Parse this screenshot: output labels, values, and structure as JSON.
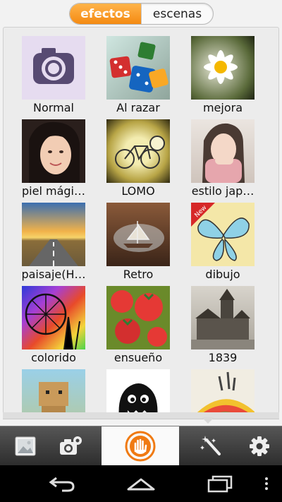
{
  "tabs": [
    {
      "label": "efectos",
      "active": true
    },
    {
      "label": "escenas",
      "active": false
    }
  ],
  "effects": [
    {
      "label": "Normal"
    },
    {
      "label": "Al razar"
    },
    {
      "label": "mejora"
    },
    {
      "label": "piel mági…"
    },
    {
      "label": "LOMO"
    },
    {
      "label": "estilo jap…"
    },
    {
      "label": "paisaje(H…"
    },
    {
      "label": "Retro"
    },
    {
      "label": "dibujo",
      "badge": "New"
    },
    {
      "label": "colorido"
    },
    {
      "label": "ensueño"
    },
    {
      "label": "1839"
    },
    {
      "label": ""
    },
    {
      "label": ""
    },
    {
      "label": ""
    }
  ],
  "toolbar": {
    "items": [
      "gallery-icon",
      "camera-settings-icon",
      "hand-shutter-icon",
      "magic-wand-icon",
      "gear-icon"
    ],
    "accent": "#f07a12"
  },
  "navbar": {
    "items": [
      "back-icon",
      "home-icon",
      "recent-apps-icon",
      "overflow-menu-icon"
    ]
  }
}
